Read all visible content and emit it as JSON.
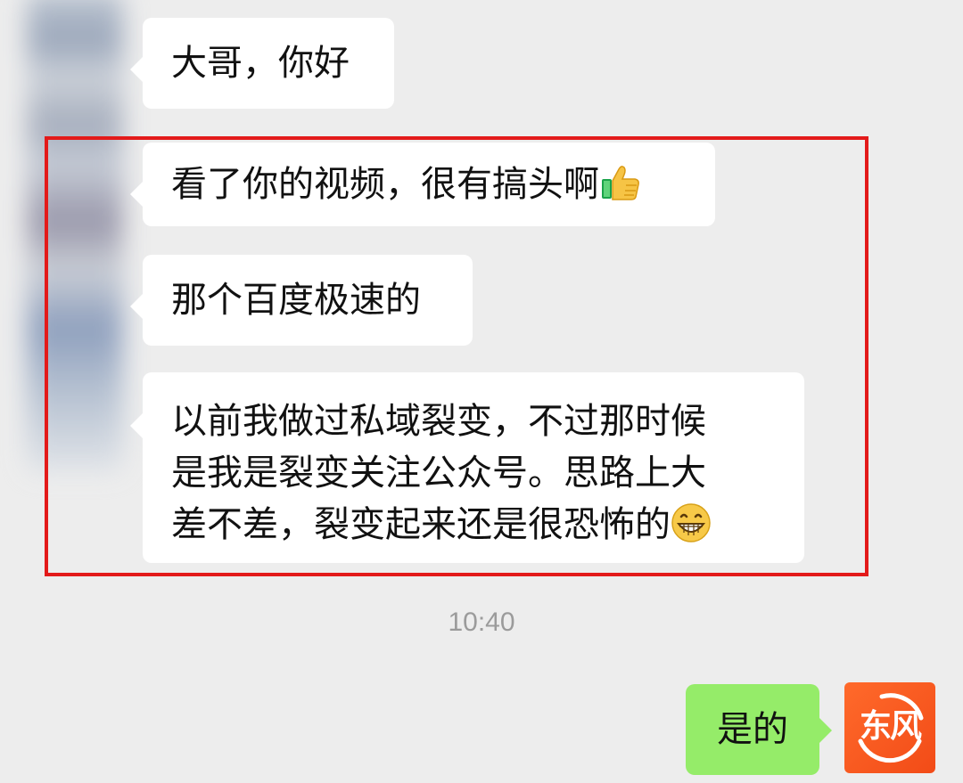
{
  "messages": [
    {
      "sender": "other",
      "text": "大哥，你好"
    },
    {
      "sender": "other",
      "text": "看了你的视频，很有搞头啊",
      "emoji": "thumbs-up-icon"
    },
    {
      "sender": "other",
      "text": "那个百度极速的"
    },
    {
      "sender": "other",
      "lines": [
        "以前我做过私域裂变，不过那时候",
        "是我是裂变关注公众号。思路上大",
        "差不差，裂变起来还是很恐怖的"
      ],
      "emoji": "grinning-face-icon"
    }
  ],
  "timestamp": "10:40",
  "self_message": {
    "text": "是的"
  },
  "self_avatar": {
    "logo_text": "东风"
  },
  "colors": {
    "background": "#ededed",
    "bubble_other": "#ffffff",
    "bubble_self": "#95ec69",
    "highlight": "#e31a1a",
    "avatar": "#f24b17"
  }
}
